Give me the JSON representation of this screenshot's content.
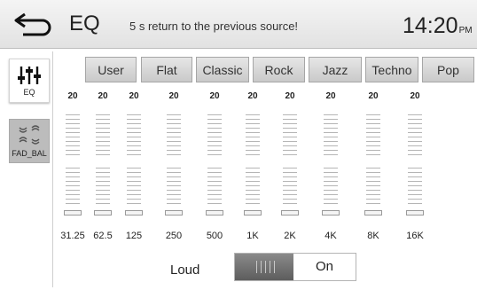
{
  "header": {
    "title": "EQ",
    "hint": "5  s return to the previous source!",
    "clock": "14:20",
    "ampm": "PM"
  },
  "sidebar": {
    "items": [
      {
        "label": "EQ",
        "icon": "equalizer-icon"
      },
      {
        "label": "FAD_BAL",
        "icon": "speakers-icon"
      }
    ]
  },
  "presets": [
    "User",
    "Flat",
    "Classic",
    "Rock",
    "Jazz",
    "Techno",
    "Pop"
  ],
  "bands": {
    "gains": [
      "20",
      "20",
      "20",
      "20",
      "20",
      "20",
      "20",
      "20",
      "20",
      "20"
    ],
    "frequencies": [
      "31.25",
      "62.5",
      "125",
      "250",
      "500",
      "1K",
      "2K",
      "4K",
      "8K",
      "16K"
    ]
  },
  "loud": {
    "label": "Loud",
    "state": "On"
  }
}
